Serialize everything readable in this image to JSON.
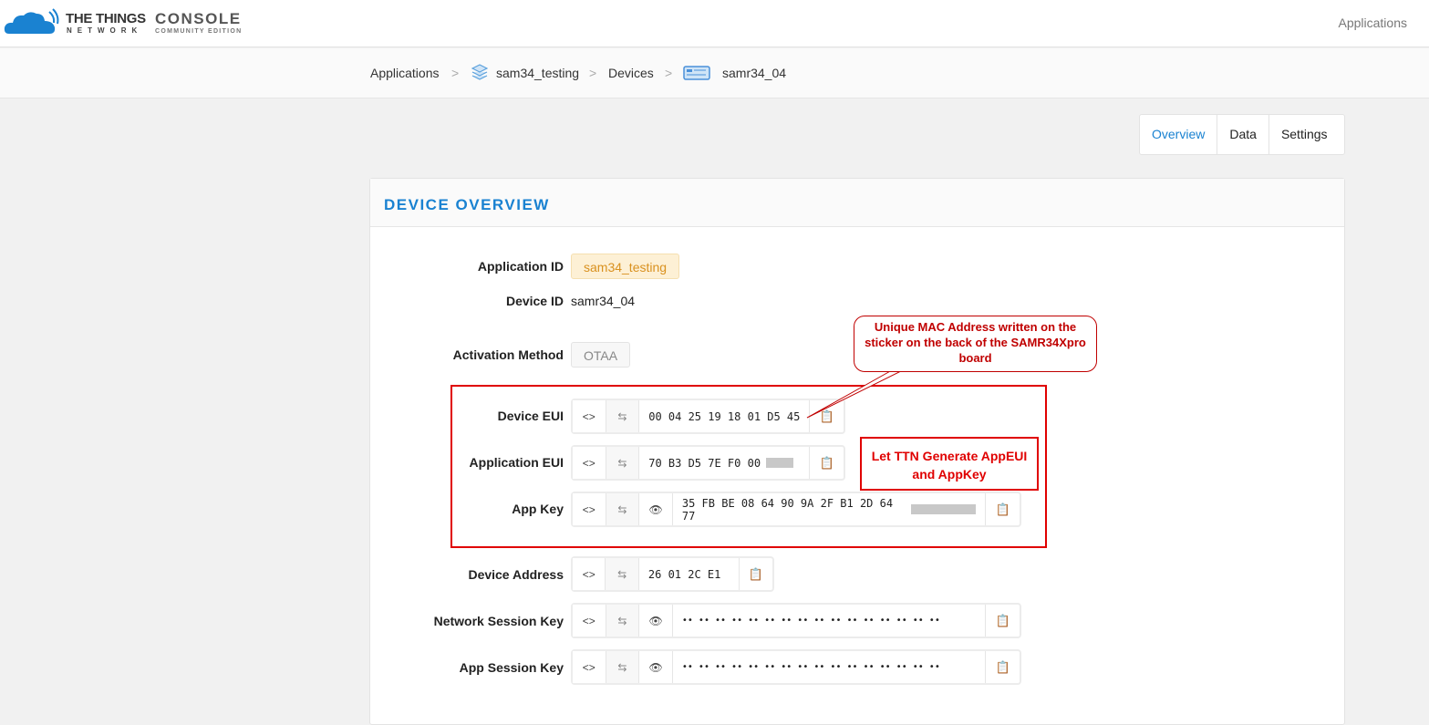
{
  "header": {
    "logo_line1": "THE THINGS",
    "logo_line2": "NETWORK",
    "product": "CONSOLE",
    "edition": "COMMUNITY EDITION",
    "nav_applications": "Applications"
  },
  "breadcrumb": {
    "items": [
      "Applications",
      "sam34_testing",
      "Devices",
      "samr34_04"
    ]
  },
  "tabs": [
    {
      "label": "Overview",
      "active": true
    },
    {
      "label": "Data"
    },
    {
      "label": "Settings"
    }
  ],
  "card": {
    "title": "DEVICE OVERVIEW"
  },
  "fields": {
    "application_id": {
      "label": "Application ID",
      "value": "sam34_testing"
    },
    "device_id": {
      "label": "Device ID",
      "value": "samr34_04"
    },
    "activation": {
      "label": "Activation Method",
      "value": "OTAA"
    },
    "device_eui": {
      "label": "Device EUI",
      "value": "00 04 25 19 18 01 D5 45"
    },
    "app_eui": {
      "label": "Application EUI",
      "value": "70 B3 D5 7E F0 00"
    },
    "app_key": {
      "label": "App Key",
      "value": "35 FB BE 08 64 90 9A 2F B1 2D 64 77"
    },
    "device_address": {
      "label": "Device Address",
      "value": "26 01 2C E1"
    },
    "nwk_skey": {
      "label": "Network Session Key",
      "value": "•• •• •• •• •• •• •• •• •• •• •• •• •• •• •• ••"
    },
    "app_skey": {
      "label": "App Session Key",
      "value": "•• •• •• •• •• •• •• •• •• •• •• •• •• •• •• ••"
    }
  },
  "annotations": {
    "bubble": "Unique MAC Address written on the sticker on the back of the SAMR34Xpro board",
    "note": "Let TTN Generate AppEUI and AppKey"
  },
  "colors": {
    "accent": "#1a82d1",
    "annotation": "#e00000"
  }
}
